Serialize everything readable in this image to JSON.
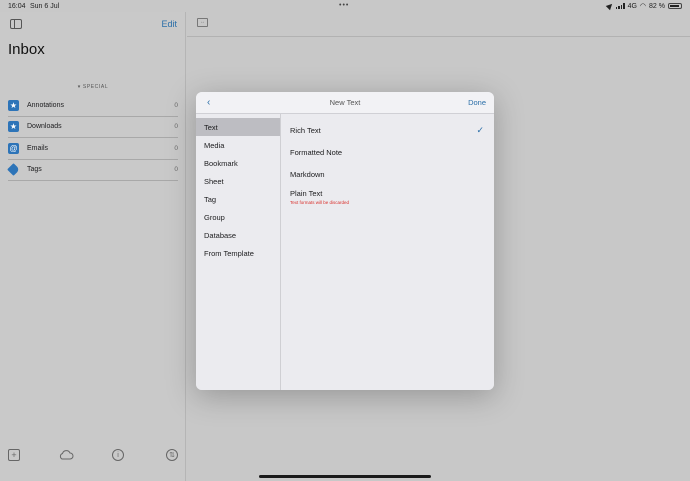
{
  "status_bar": {
    "time": "16:04",
    "date": "Sun 6 Jul",
    "network": "4G",
    "battery": "82 %"
  },
  "sidebar": {
    "title": "Inbox",
    "edit_label": "Edit",
    "section_label": "▾ SPECIAL",
    "items": [
      {
        "label": "Annotations",
        "count": "0",
        "icon": "star-icon",
        "color": "#2d74b8"
      },
      {
        "label": "Downloads",
        "count": "0",
        "icon": "star-icon",
        "color": "#2d74b8"
      },
      {
        "label": "Emails",
        "count": "0",
        "icon": "at-icon",
        "color": "#2d74b8"
      },
      {
        "label": "Tags",
        "count": "0",
        "icon": "tag-icon",
        "color": "#2d74b8"
      }
    ],
    "footer_icons": [
      "add-icon",
      "cloud-icon",
      "info-icon",
      "sync-icon"
    ]
  },
  "modal": {
    "title": "New Text",
    "done_label": "Done",
    "back_icon": "chevron-left-icon",
    "categories": [
      "Text",
      "Media",
      "Bookmark",
      "Sheet",
      "Tag",
      "Group",
      "Database",
      "From Template"
    ],
    "selected_category": "Text",
    "options": [
      {
        "label": "Rich Text",
        "checked": true,
        "note": ""
      },
      {
        "label": "Formatted Note",
        "checked": false,
        "note": ""
      },
      {
        "label": "Markdown",
        "checked": false,
        "note": ""
      },
      {
        "label": "Plain Text",
        "checked": false,
        "note": "Text formats will be discarded"
      }
    ]
  },
  "colors": {
    "accent": "#2a6ea8",
    "warning": "#d9302c",
    "selected_row": "#bdbdc2"
  }
}
